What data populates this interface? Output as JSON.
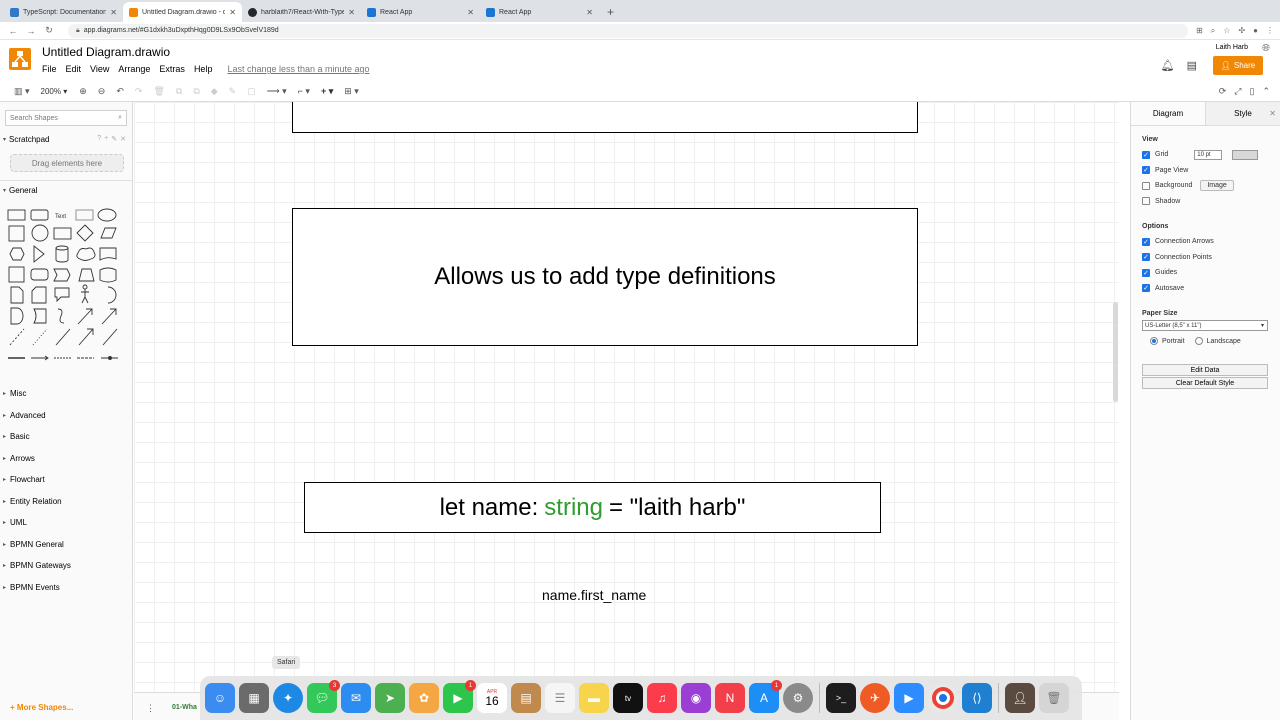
{
  "browser": {
    "tabs": [
      {
        "title": "TypeScript: Documentation - E",
        "color": "#3178c6"
      },
      {
        "title": "Untitled Diagram.drawio - diag",
        "color": "#f08705"
      },
      {
        "title": "harblaith7/React-With-TypeSc",
        "color": "#24292e"
      },
      {
        "title": "React App",
        "color": "#1976d2"
      },
      {
        "title": "React App",
        "color": "#1976d2"
      }
    ],
    "url": "app.diagrams.net/#G1dxkh3uDxpthHqg0D9LSx9ObSvelV189d"
  },
  "header": {
    "doc_title": "Untitled Diagram.drawio",
    "menu": [
      "File",
      "Edit",
      "View",
      "Arrange",
      "Extras",
      "Help"
    ],
    "last_change": "Last change less than a minute ago",
    "user": "Laith Harb",
    "share_label": "Share"
  },
  "toolbar": {
    "zoom": "200%"
  },
  "sidebar": {
    "search_placeholder": "Search Shapes",
    "scratchpad": "Scratchpad",
    "drag_hint": "Drag elements here",
    "general": "General",
    "categories": [
      "Misc",
      "Advanced",
      "Basic",
      "Arrows",
      "Flowchart",
      "Entity Relation",
      "UML",
      "BPMN General",
      "BPMN Gateways",
      "BPMN Events"
    ],
    "more_shapes": "More Shapes..."
  },
  "canvas": {
    "box2_text": "Allows us to add type definitions",
    "box3": {
      "before": "let name:",
      "type": "string",
      "after": "= \"laith harb\""
    },
    "free_text": "name.first_name",
    "type_color": "#2e9e2e"
  },
  "pagebar": {
    "page_tab": "01-Wha"
  },
  "right_panel": {
    "tab_diagram": "Diagram",
    "tab_style": "Style",
    "view_title": "View",
    "view_options": [
      {
        "label": "Grid",
        "checked": true
      },
      {
        "label": "Page View",
        "checked": true
      },
      {
        "label": "Background",
        "checked": false
      },
      {
        "label": "Shadow",
        "checked": false
      }
    ],
    "grid_size": "10 pt",
    "image_label": "Image",
    "options_title": "Options",
    "options": [
      {
        "label": "Connection Arrows",
        "checked": true
      },
      {
        "label": "Connection Points",
        "checked": true
      },
      {
        "label": "Guides",
        "checked": true
      },
      {
        "label": "Autosave",
        "checked": true
      }
    ],
    "paper_title": "Paper Size",
    "paper_value": "US-Letter (8,5\" x 11\")",
    "portrait": "Portrait",
    "landscape": "Landscape",
    "edit_data": "Edit Data",
    "clear_style": "Clear Default Style"
  },
  "dock": {
    "tooltip": "Safari",
    "calendar_month": "APR",
    "calendar_day": "16",
    "apps": [
      {
        "name": "finder",
        "color": "#3b8cf0"
      },
      {
        "name": "launchpad",
        "color": "#6b6b6b"
      },
      {
        "name": "safari",
        "color": "#1e88e5"
      },
      {
        "name": "messages",
        "color": "#34c759",
        "badge": "3"
      },
      {
        "name": "mail",
        "color": "#2d8cf0"
      },
      {
        "name": "maps",
        "color": "#4caf50"
      },
      {
        "name": "photos",
        "color": "#f4a742"
      },
      {
        "name": "facetime",
        "color": "#2ec54c",
        "badge": "1"
      },
      {
        "name": "calendar",
        "color": "#ffffff"
      },
      {
        "name": "contacts",
        "color": "#c08a4e"
      },
      {
        "name": "reminders",
        "color": "#f5f5f5"
      },
      {
        "name": "notes",
        "color": "#f7d44c"
      },
      {
        "name": "tv",
        "color": "#111111"
      },
      {
        "name": "music",
        "color": "#fa3c4c"
      },
      {
        "name": "podcasts",
        "color": "#9b3fd4"
      },
      {
        "name": "news",
        "color": "#f23f4a"
      },
      {
        "name": "app-store",
        "color": "#1c8ef5",
        "badge": "1"
      },
      {
        "name": "system-preferences",
        "color": "#8a8a8a"
      },
      {
        "name": "terminal",
        "color": "#1d1d1d"
      },
      {
        "name": "postman",
        "color": "#ef5b25"
      },
      {
        "name": "zoom",
        "color": "#2d8cff"
      },
      {
        "name": "chrome",
        "color": "#e8e8e8"
      },
      {
        "name": "vscode",
        "color": "#1f7fd1"
      },
      {
        "name": "camera",
        "color": "#5a4a3f"
      },
      {
        "name": "trash",
        "color": "#d5d5d5"
      }
    ]
  }
}
